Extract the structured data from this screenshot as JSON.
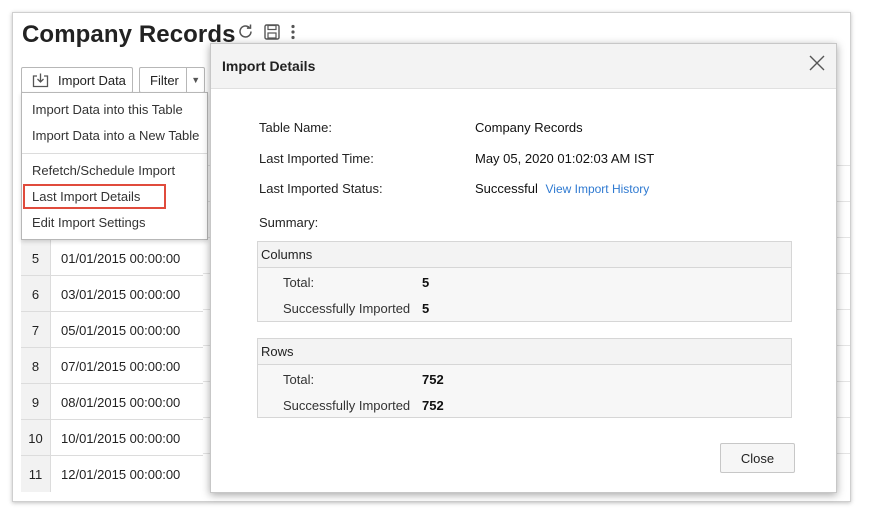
{
  "page": {
    "title": "Company Records"
  },
  "toolbar": {
    "import_label": "Import Data",
    "filter_label": "Filter"
  },
  "import_menu": {
    "items": [
      "Import Data into this Table",
      "Import Data into a New Table",
      "Refetch/Schedule Import",
      "Last Import Details",
      "Edit Import Settings"
    ],
    "highlighted": "Last Import Details",
    "highlight_color": "#e04b3c"
  },
  "table": {
    "rows": [
      {
        "num": "5",
        "date": "01/01/2015 00:00:00"
      },
      {
        "num": "6",
        "date": "03/01/2015 00:00:00"
      },
      {
        "num": "7",
        "date": "05/01/2015 00:00:00"
      },
      {
        "num": "8",
        "date": "07/01/2015 00:00:00"
      },
      {
        "num": "9",
        "date": "08/01/2015 00:00:00"
      },
      {
        "num": "10",
        "date": "10/01/2015 00:00:00"
      },
      {
        "num": "11",
        "date": "12/01/2015 00:00:00"
      }
    ]
  },
  "modal": {
    "title": "Import Details",
    "table_name_label": "Table Name:",
    "table_name_value": "Company Records",
    "time_label": "Last Imported Time:",
    "time_value": "May 05, 2020 01:02:03 AM IST",
    "status_label": "Last Imported Status:",
    "status_value": "Successful",
    "history_link": "View Import History",
    "link_color": "#2f7ad1",
    "summary_label": "Summary:",
    "columns": {
      "heading": "Columns",
      "total_label": "Total:",
      "total_value": "5",
      "imported_label": "Successfully Imported",
      "imported_value": "5"
    },
    "rows": {
      "heading": "Rows",
      "total_label": "Total:",
      "total_value": "752",
      "imported_label": "Successfully Imported",
      "imported_value": "752"
    },
    "close_label": "Close"
  },
  "icons": [
    "refresh-icon",
    "save-icon",
    "more-vertical-icon",
    "import-icon",
    "chevron-down-icon",
    "close-icon"
  ]
}
